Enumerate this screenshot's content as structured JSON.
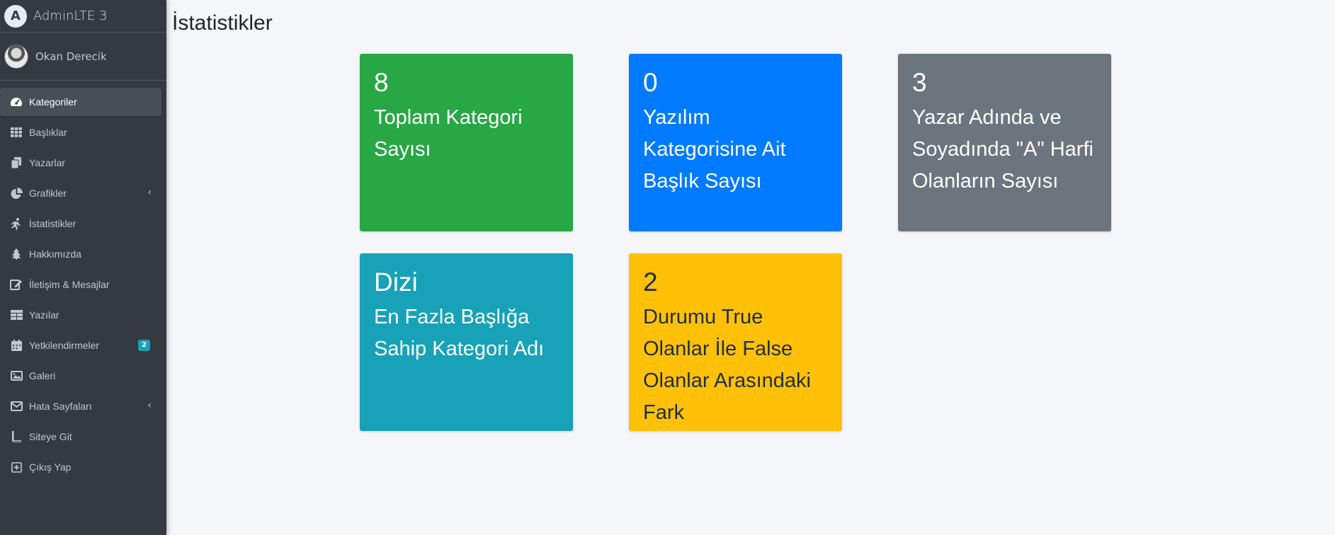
{
  "brand": {
    "logo_letter": "A",
    "title": "AdminLTE 3"
  },
  "user": {
    "name": "Okan Derecik"
  },
  "sidebar": {
    "items": [
      {
        "label": "Kategoriler",
        "icon": "tachometer-icon",
        "active": true
      },
      {
        "label": "Başlıklar",
        "icon": "grid-icon"
      },
      {
        "label": "Yazarlar",
        "icon": "copy-icon"
      },
      {
        "label": "Grafikler",
        "icon": "chart-pie-icon",
        "chevron": "‹"
      },
      {
        "label": "İstatistikler",
        "icon": "running-icon"
      },
      {
        "label": "Hakkımızda",
        "icon": "tree-icon"
      },
      {
        "label": "İletişim & Mesajlar",
        "icon": "edit-icon"
      },
      {
        "label": "Yazılar",
        "icon": "table-icon"
      },
      {
        "label": "Yetkilendirmeler",
        "icon": "calendar-icon",
        "badge": "2"
      },
      {
        "label": "Galeri",
        "icon": "image-icon"
      },
      {
        "label": "Hata Sayfaları",
        "icon": "envelope-icon",
        "chevron": "‹"
      },
      {
        "label": "Siteye Git",
        "icon": "book-icon"
      },
      {
        "label": "Çıkış Yap",
        "icon": "plus-square-icon"
      }
    ]
  },
  "main": {
    "title": "İstatistikler",
    "cards": [
      {
        "value": "8",
        "description": "Toplam Kategori Sayısı",
        "color": "#28a745"
      },
      {
        "value": "0",
        "description": "Yazılım Kategorisine Ait Başlık Sayısı",
        "color": "#007bff"
      },
      {
        "value": "3",
        "description": "Yazar Adında ve Soyadında \"A\" Harfi Olanların Sayısı",
        "color": "#6c757d"
      },
      {
        "value": "Dizi",
        "description": "En Fazla Başlığa Sahip Kategori Adı",
        "color": "#17a2b8"
      },
      {
        "value": "2",
        "description": "Durumu True Olanlar İle False Olanlar Arasındaki Fark",
        "color": "#ffc107"
      }
    ]
  }
}
